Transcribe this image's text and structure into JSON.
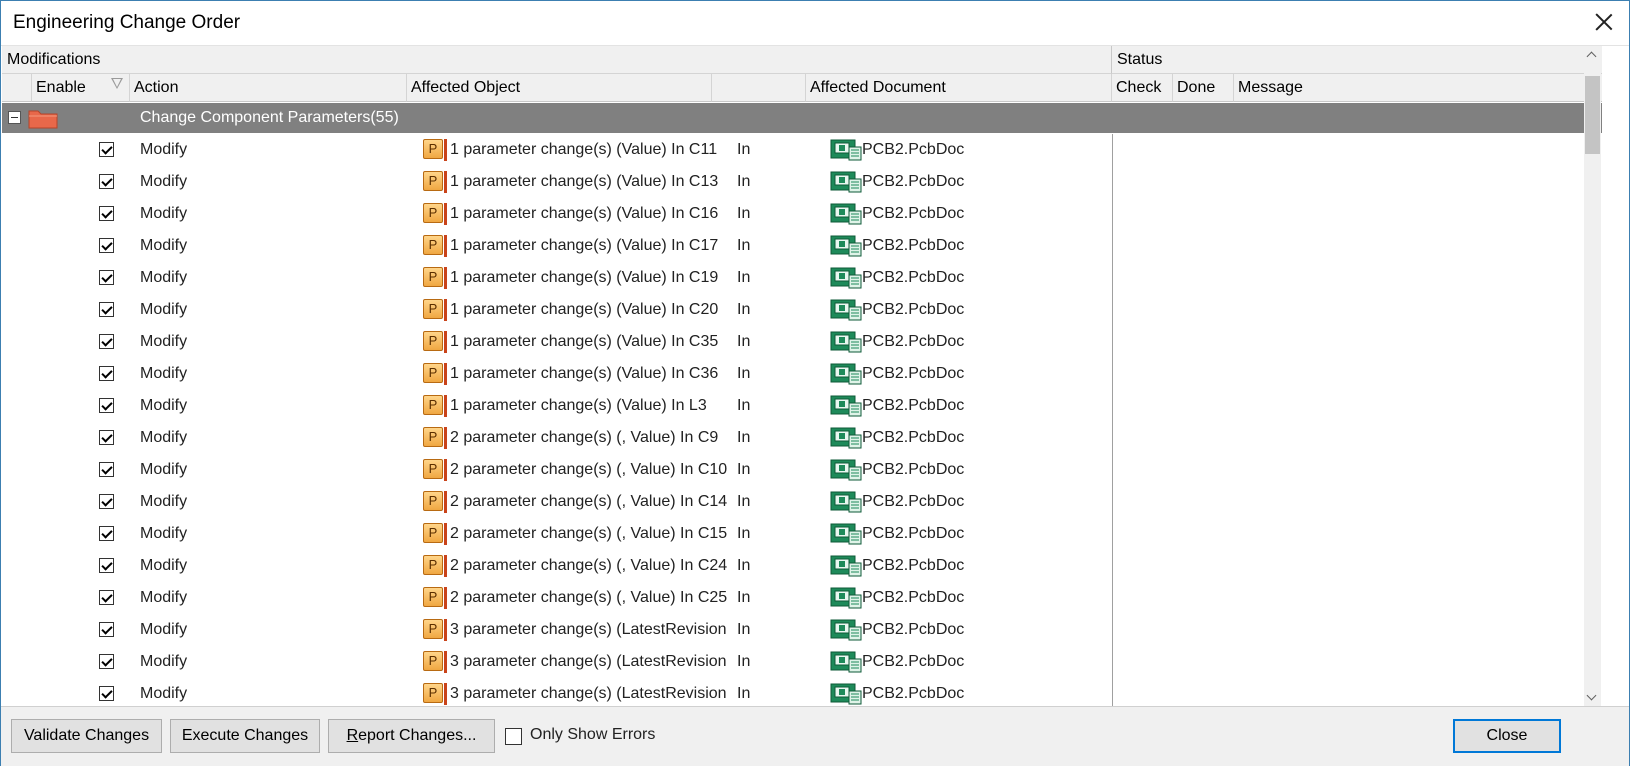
{
  "window": {
    "title": "Engineering Change Order",
    "close_icon": "close-icon"
  },
  "groups": {
    "modifications": "Modifications",
    "status": "Status"
  },
  "columns": {
    "enable": "Enable",
    "action": "Action",
    "affected_object": "Affected Object",
    "affected_document": "Affected Document",
    "check": "Check",
    "done": "Done",
    "message": "Message"
  },
  "group_row": {
    "label": "Change Component Parameters(55)",
    "expanded": true
  },
  "rows": [
    {
      "enabled": true,
      "action": "Modify",
      "object": "1 parameter change(s) (Value) In C11",
      "in": "In",
      "document": "PCB2.PcbDoc"
    },
    {
      "enabled": true,
      "action": "Modify",
      "object": "1 parameter change(s) (Value) In C13",
      "in": "In",
      "document": "PCB2.PcbDoc"
    },
    {
      "enabled": true,
      "action": "Modify",
      "object": "1 parameter change(s) (Value) In C16",
      "in": "In",
      "document": "PCB2.PcbDoc"
    },
    {
      "enabled": true,
      "action": "Modify",
      "object": "1 parameter change(s) (Value) In C17",
      "in": "In",
      "document": "PCB2.PcbDoc"
    },
    {
      "enabled": true,
      "action": "Modify",
      "object": "1 parameter change(s) (Value) In C19",
      "in": "In",
      "document": "PCB2.PcbDoc"
    },
    {
      "enabled": true,
      "action": "Modify",
      "object": "1 parameter change(s) (Value) In C20",
      "in": "In",
      "document": "PCB2.PcbDoc"
    },
    {
      "enabled": true,
      "action": "Modify",
      "object": "1 parameter change(s) (Value) In C35",
      "in": "In",
      "document": "PCB2.PcbDoc"
    },
    {
      "enabled": true,
      "action": "Modify",
      "object": "1 parameter change(s) (Value) In C36",
      "in": "In",
      "document": "PCB2.PcbDoc"
    },
    {
      "enabled": true,
      "action": "Modify",
      "object": "1 parameter change(s) (Value) In L3",
      "in": "In",
      "document": "PCB2.PcbDoc"
    },
    {
      "enabled": true,
      "action": "Modify",
      "object": "2 parameter change(s) (, Value) In C9",
      "in": "In",
      "document": "PCB2.PcbDoc"
    },
    {
      "enabled": true,
      "action": "Modify",
      "object": "2 parameter change(s) (, Value) In C10",
      "in": "In",
      "document": "PCB2.PcbDoc"
    },
    {
      "enabled": true,
      "action": "Modify",
      "object": "2 parameter change(s) (, Value) In C14",
      "in": "In",
      "document": "PCB2.PcbDoc"
    },
    {
      "enabled": true,
      "action": "Modify",
      "object": "2 parameter change(s) (, Value) In C15",
      "in": "In",
      "document": "PCB2.PcbDoc"
    },
    {
      "enabled": true,
      "action": "Modify",
      "object": "2 parameter change(s) (, Value) In C24",
      "in": "In",
      "document": "PCB2.PcbDoc"
    },
    {
      "enabled": true,
      "action": "Modify",
      "object": "2 parameter change(s) (, Value) In C25",
      "in": "In",
      "document": "PCB2.PcbDoc"
    },
    {
      "enabled": true,
      "action": "Modify",
      "object": "3 parameter change(s) (LatestRevision",
      "in": "In",
      "document": "PCB2.PcbDoc"
    },
    {
      "enabled": true,
      "action": "Modify",
      "object": "3 parameter change(s) (LatestRevision",
      "in": "In",
      "document": "PCB2.PcbDoc"
    },
    {
      "enabled": true,
      "action": "Modify",
      "object": "3 parameter change(s) (LatestRevision",
      "in": "In",
      "document": "PCB2.PcbDoc"
    }
  ],
  "icons": {
    "param": "parameter-icon",
    "pcb": "pcb-document-icon",
    "folder": "folder-icon"
  },
  "buttons": {
    "validate": "Validate Changes",
    "execute": "Execute Changes",
    "report_underline": "R",
    "report_rest": "eport Changes...",
    "close": "Close"
  },
  "only_show_errors": {
    "label": "Only Show Errors",
    "checked": false
  },
  "colors": {
    "group_row_bg": "#808080",
    "accent": "#0078d7",
    "param_icon": "#f0a742",
    "pcb_icon": "#1e8a5a"
  }
}
